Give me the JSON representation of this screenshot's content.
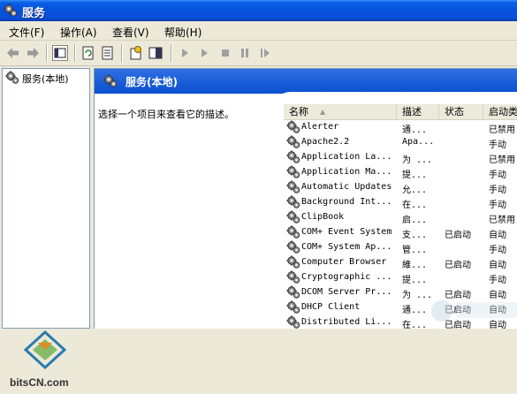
{
  "window": {
    "title": "服务"
  },
  "menu": [
    {
      "label": "文件(F)"
    },
    {
      "label": "操作(A)"
    },
    {
      "label": "查看(V)"
    },
    {
      "label": "帮助(H)"
    }
  ],
  "toolbar": {
    "icons": [
      "back-arrow-icon",
      "forward-arrow-icon",
      "show-hide-tree-icon",
      "refresh-icon",
      "export-list-icon",
      "properties-icon",
      "help-panel-icon",
      "start-service-icon",
      "start-service-alt-icon",
      "stop-service-icon",
      "pause-service-icon",
      "restart-service-icon"
    ]
  },
  "tree": {
    "root_label": "服务(本地)"
  },
  "panel": {
    "header": "服务(本地)",
    "description": "选择一个项目来查看它的描述。"
  },
  "columns": {
    "name": "名称",
    "desc": "描述",
    "status": "状态",
    "startup": "启动类"
  },
  "services": [
    {
      "name": "Alerter",
      "desc": "通...",
      "status": "",
      "startup": "已禁用"
    },
    {
      "name": "Apache2.2",
      "desc": "Apa...",
      "status": "",
      "startup": "手动"
    },
    {
      "name": "Application La...",
      "desc": "为 ...",
      "status": "",
      "startup": "已禁用"
    },
    {
      "name": "Application Ma...",
      "desc": "提...",
      "status": "",
      "startup": "手动"
    },
    {
      "name": "Automatic Updates",
      "desc": "允...",
      "status": "",
      "startup": "手动"
    },
    {
      "name": "Background Int...",
      "desc": "在...",
      "status": "",
      "startup": "手动"
    },
    {
      "name": "ClipBook",
      "desc": "启...",
      "status": "",
      "startup": "已禁用"
    },
    {
      "name": "COM+ Event System",
      "desc": "支...",
      "status": "已启动",
      "startup": "自动"
    },
    {
      "name": "COM+ System Ap...",
      "desc": "管...",
      "status": "",
      "startup": "手动"
    },
    {
      "name": "Computer Browser",
      "desc": "維...",
      "status": "已启动",
      "startup": "自动"
    },
    {
      "name": "Cryptographic ...",
      "desc": "提...",
      "status": "",
      "startup": "手动"
    },
    {
      "name": "DCOM Server Pr...",
      "desc": "为 ...",
      "status": "已启动",
      "startup": "自动"
    },
    {
      "name": "DHCP Client",
      "desc": "通...",
      "status": "已启动",
      "startup": "自动"
    },
    {
      "name": "Distributed Li...",
      "desc": "在...",
      "status": "已启动",
      "startup": "自动"
    }
  ],
  "watermark": {
    "text": "bitsCN.com"
  },
  "colors": {
    "titlebar": "#0551dc",
    "panel_header": "#0b4fd2",
    "chrome": "#ece9d8"
  }
}
